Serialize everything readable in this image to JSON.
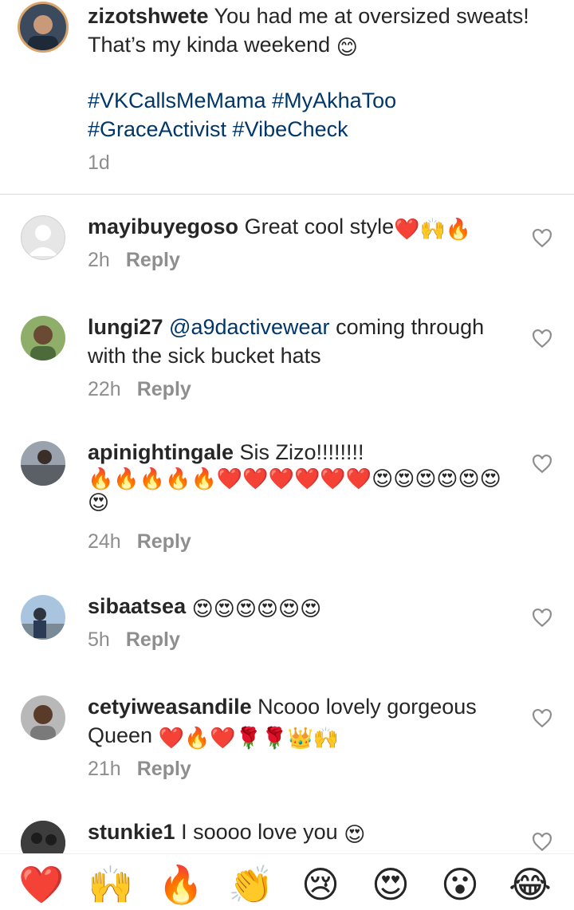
{
  "caption": {
    "username": "zizotshwete",
    "text": "You had me at oversized sweats! That’s my kinda weekend",
    "text_emoji": "😊",
    "hashtags_line1": "#VKCallsMeMama #MyAkhaToo",
    "hashtags_line2": "#GraceActivist #VibeCheck",
    "time": "1d"
  },
  "reply_label": "Reply",
  "comments": [
    {
      "username": "mayibuyegoso",
      "text": "Great cool style",
      "emoji": "❤️🙌🔥",
      "time": "2h"
    },
    {
      "username": "lungi27",
      "mention": "@a9dactivewear",
      "text": "coming through with the sick bucket hats",
      "time": "22h"
    },
    {
      "username": "apinightingale",
      "text": "Sis Zizo!!!!!!!!",
      "emoji": "🔥🔥🔥🔥🔥❤️❤️❤️❤️❤️❤️😍😍😍😍😍😍😍",
      "time": "24h"
    },
    {
      "username": "sibaatsea",
      "emoji": "😍😍😍😍😍😍",
      "time": "5h"
    },
    {
      "username": "cetyiweasandile",
      "text": "Ncooo lovely gorgeous Queen",
      "emoji": "❤️🔥❤️🌹🌹👑🙌",
      "time": "21h"
    },
    {
      "username": "stunkie1",
      "text": "I soooo love you",
      "emoji": "😍"
    }
  ],
  "emoji_bar": [
    "❤️",
    "🙌",
    "🔥",
    "👏",
    "😢",
    "😍",
    "😮",
    "😂"
  ],
  "colors": {
    "link": "#00376b",
    "meta": "#8e8e8e",
    "heart": "#ed4956"
  }
}
